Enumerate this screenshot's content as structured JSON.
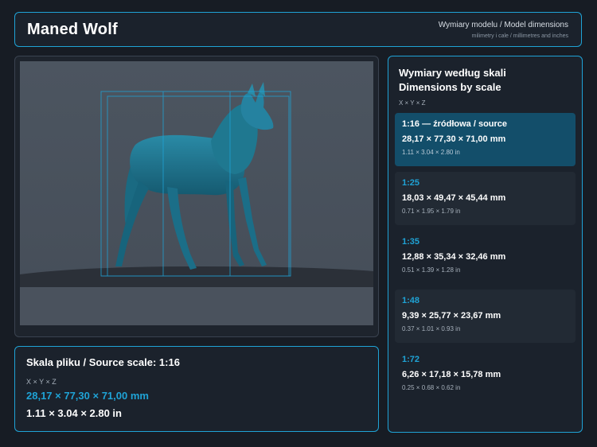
{
  "header": {
    "title": "Maned Wolf",
    "subtitle": "Wymiary modelu / Model dimensions",
    "caption": "milimetry i cale / millimetres and inches"
  },
  "viewer": {
    "model_icon": "wolf-3d-model",
    "bbox_color": "#1fa3d6"
  },
  "source_scale": {
    "title": "Skala pliku / Source scale: 1:16",
    "axes": "X × Y × Z",
    "mm": "28,17 × 77,30 × 71,00 mm",
    "inches": "1.11 × 3.04 × 2.80 in"
  },
  "scales_panel": {
    "title_pl": "Wymiary według skali",
    "title_en": "Dimensions by scale",
    "axes": "X × Y × Z",
    "items": [
      {
        "label": "1:16  —  źródłowa / source",
        "mm": "28,17 × 77,30 × 71,00 mm",
        "inches": "1.11 × 3.04 × 2.80 in",
        "active": true
      },
      {
        "label": "1:25",
        "mm": "18,03 × 49,47 × 45,44 mm",
        "inches": "0.71 × 1.95 × 1.79 in"
      },
      {
        "label": "1:35",
        "mm": "12,88 × 35,34 × 32,46 mm",
        "inches": "0.51 × 1.39 × 1.28 in"
      },
      {
        "label": "1:48",
        "mm": "9,39 × 25,77 × 23,67 mm",
        "inches": "0.37 × 1.01 × 0.93 in"
      },
      {
        "label": "1:72",
        "mm": "6,26 × 17,18 × 15,78 mm",
        "inches": "0.25 × 0.68 × 0.62 in"
      }
    ]
  },
  "colors": {
    "accent": "#1fa3d6",
    "background": "#171c24",
    "panel": "#1b222c",
    "active_item": "#134e6a",
    "model": "#1b6e86"
  }
}
